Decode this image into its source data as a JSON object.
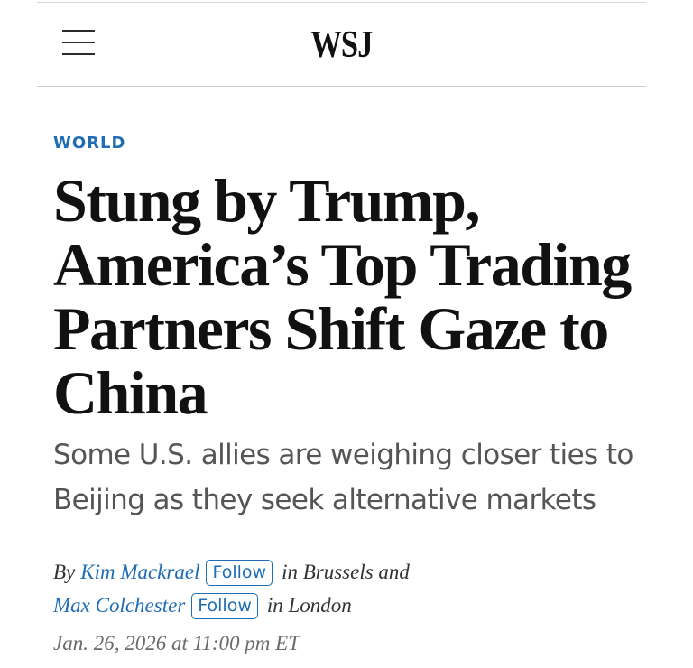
{
  "header": {
    "logo_text": "WSJ",
    "menu_icon": "hamburger-menu-icon"
  },
  "article": {
    "category": "WORLD",
    "headline": "Stung by Trump, America’s Top Trading Partners Shift Gaze to China",
    "dek": "Some U.S. allies are weighing closer ties to Beijing as they seek alternative markets",
    "byline": {
      "by": "By",
      "authors": [
        {
          "name": "Kim Mackrael",
          "follow_label": "Follow",
          "location": "in Brussels and"
        },
        {
          "name": "Max Colchester",
          "follow_label": "Follow",
          "location": "in London"
        }
      ]
    },
    "timestamp": "Jan. 26, 2026 at 11:00 pm ET"
  },
  "colors": {
    "accent": "#1f6db4",
    "text": "#111111",
    "dek": "#555555",
    "timestamp": "#6a6a6a"
  }
}
